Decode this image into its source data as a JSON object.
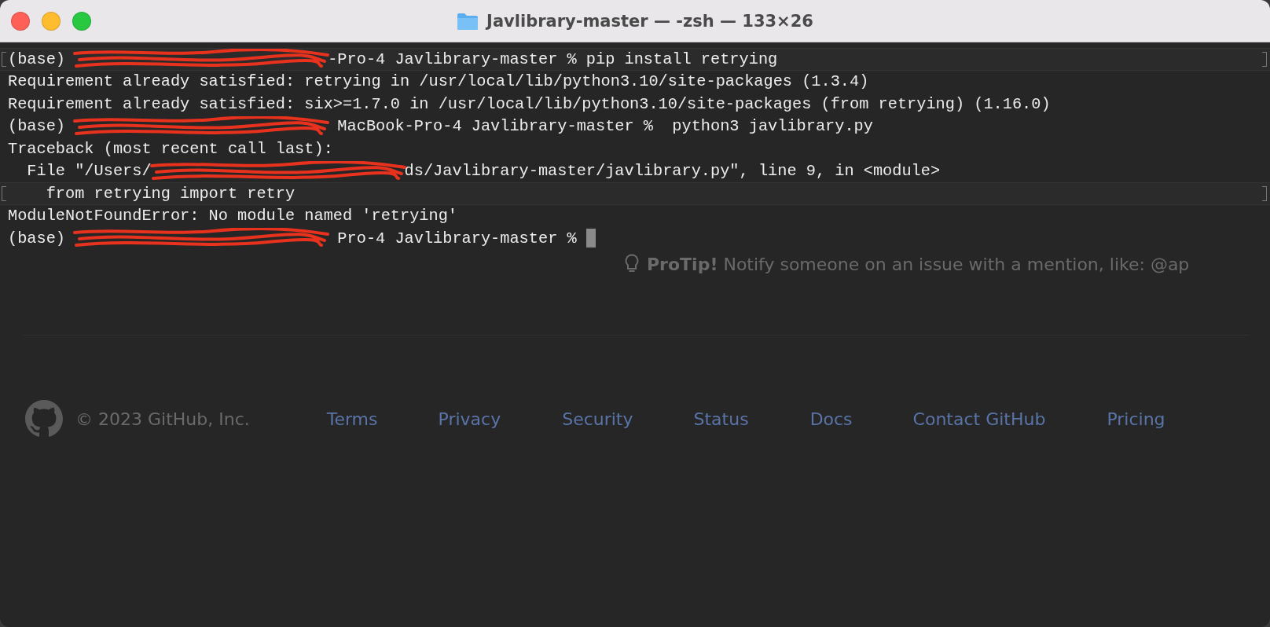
{
  "window": {
    "title": "Javlibrary-master — -zsh — 133×26"
  },
  "terminal": {
    "lines": [
      {
        "marked": true,
        "segments": [
          {
            "kind": "text",
            "text": "(base) "
          },
          {
            "kind": "redaction"
          },
          {
            "kind": "text",
            "text": "-Pro-4 Javlibrary-master % pip install retrying"
          }
        ]
      },
      {
        "marked": false,
        "segments": [
          {
            "kind": "text",
            "text": "Requirement already satisfied: retrying in /usr/local/lib/python3.10/site-packages (1.3.4)"
          }
        ]
      },
      {
        "marked": false,
        "segments": [
          {
            "kind": "text",
            "text": "Requirement already satisfied: six>=1.7.0 in /usr/local/lib/python3.10/site-packages (from retrying) (1.16.0)"
          }
        ]
      },
      {
        "marked": false,
        "segments": [
          {
            "kind": "text",
            "text": "(base) "
          },
          {
            "kind": "redaction"
          },
          {
            "kind": "text",
            "text": " MacBook-Pro-4 Javlibrary-master %  python3 javlibrary.py"
          }
        ]
      },
      {
        "marked": false,
        "segments": [
          {
            "kind": "text",
            "text": "Traceback (most recent call last):"
          }
        ]
      },
      {
        "marked": false,
        "segments": [
          {
            "kind": "text",
            "text": "  File \"/Users/"
          },
          {
            "kind": "redaction"
          },
          {
            "kind": "text",
            "text": "ds/Javlibrary-master/javlibrary.py\", line 9, in <module>"
          }
        ]
      },
      {
        "marked": true,
        "segments": [
          {
            "kind": "text",
            "text": "    from retrying import retry"
          }
        ]
      },
      {
        "marked": false,
        "segments": [
          {
            "kind": "text",
            "text": "ModuleNotFoundError: No module named 'retrying'"
          }
        ]
      },
      {
        "marked": false,
        "segments": [
          {
            "kind": "text",
            "text": "(base) "
          },
          {
            "kind": "redaction"
          },
          {
            "kind": "text",
            "text": " Pro-4 Javlibrary-master % "
          },
          {
            "kind": "cursor"
          }
        ]
      }
    ]
  },
  "background_page": {
    "protip": {
      "label": "ProTip!",
      "text": "Notify someone on an issue with a mention, like: @ap"
    },
    "footer": {
      "copyright": "© 2023 GitHub, Inc.",
      "links": [
        "Terms",
        "Privacy",
        "Security",
        "Status",
        "Docs",
        "Contact GitHub",
        "Pricing"
      ]
    }
  }
}
